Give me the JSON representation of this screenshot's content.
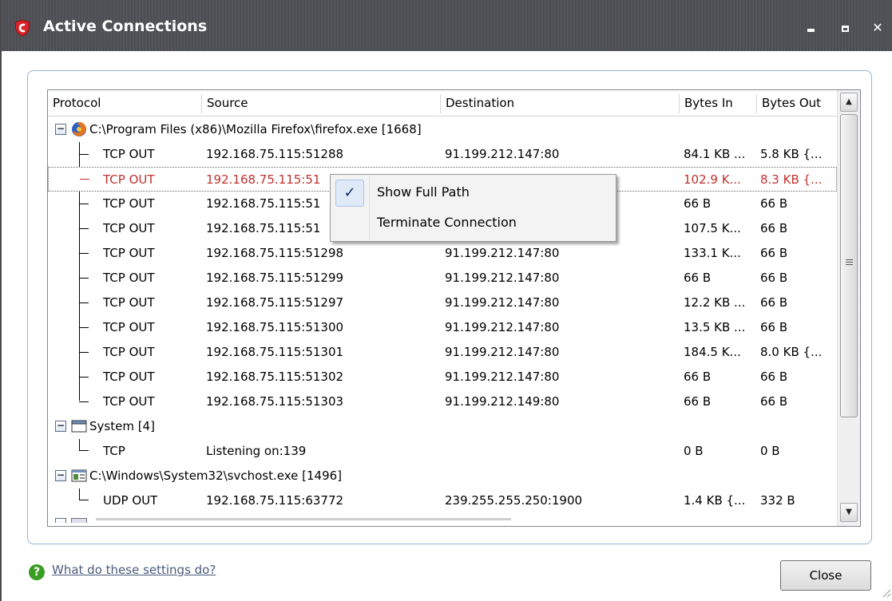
{
  "window": {
    "title": "Active Connections",
    "app_icon": "comodo-shield-icon",
    "close_glyph": "✕"
  },
  "table": {
    "columns": [
      "Protocol",
      "Source",
      "Destination",
      "Bytes In",
      "Bytes Out"
    ],
    "groups": [
      {
        "label": "C:\\Program Files (x86)\\Mozilla Firefox\\firefox.exe [1668]",
        "icon": "firefox-icon",
        "expander": "−",
        "rows": [
          {
            "protocol": "TCP OUT",
            "source": "192.168.75.115:51288",
            "destination": "91.199.212.147:80",
            "bytes_in": "84.1 KB ...",
            "bytes_out": "5.8 KB {..."
          },
          {
            "protocol": "TCP OUT",
            "source": "192.168.75.115:51",
            "destination": "",
            "bytes_in": "102.9 K...",
            "bytes_out": "8.3 KB {..."
          },
          {
            "protocol": "TCP OUT",
            "source": "192.168.75.115:51",
            "destination": "",
            "bytes_in": "66 B",
            "bytes_out": "66 B"
          },
          {
            "protocol": "TCP OUT",
            "source": "192.168.75.115:51",
            "destination": "",
            "bytes_in": "107.5 K...",
            "bytes_out": "66 B"
          },
          {
            "protocol": "TCP OUT",
            "source": "192.168.75.115:51298",
            "destination": "91.199.212.147:80",
            "bytes_in": "133.1 K...",
            "bytes_out": "66 B"
          },
          {
            "protocol": "TCP OUT",
            "source": "192.168.75.115:51299",
            "destination": "91.199.212.147:80",
            "bytes_in": "66 B",
            "bytes_out": "66 B"
          },
          {
            "protocol": "TCP OUT",
            "source": "192.168.75.115:51297",
            "destination": "91.199.212.147:80",
            "bytes_in": "12.2 KB ...",
            "bytes_out": "66 B"
          },
          {
            "protocol": "TCP OUT",
            "source": "192.168.75.115:51300",
            "destination": "91.199.212.147:80",
            "bytes_in": "13.5 KB ...",
            "bytes_out": "66 B"
          },
          {
            "protocol": "TCP OUT",
            "source": "192.168.75.115:51301",
            "destination": "91.199.212.147:80",
            "bytes_in": "184.5 K...",
            "bytes_out": "8.0 KB {..."
          },
          {
            "protocol": "TCP OUT",
            "source": "192.168.75.115:51302",
            "destination": "91.199.212.147:80",
            "bytes_in": "66 B",
            "bytes_out": "66 B"
          },
          {
            "protocol": "TCP OUT",
            "source": "192.168.75.115:51303",
            "destination": "91.199.212.149:80",
            "bytes_in": "66 B",
            "bytes_out": "66 B"
          }
        ]
      },
      {
        "label": "System [4]",
        "icon": "window-icon",
        "expander": "−",
        "rows": [
          {
            "protocol": "TCP",
            "source": "Listening on:139",
            "destination": "",
            "bytes_in": "0 B",
            "bytes_out": "0 B"
          }
        ]
      },
      {
        "label": "C:\\Windows\\System32\\svchost.exe [1496]",
        "icon": "service-window-icon",
        "expander": "−",
        "rows": [
          {
            "protocol": "UDP OUT",
            "source": "192.168.75.115:63772",
            "destination": "239.255.255.250:1900",
            "bytes_in": "1.4 KB {...",
            "bytes_out": "332 B"
          }
        ]
      }
    ],
    "selected_row": "TCP OUT 192.168.75.115:51 (row 2)"
  },
  "context_menu": {
    "items": [
      {
        "label": "Show Full Path",
        "checked": true
      },
      {
        "label": "Terminate Connection",
        "checked": false
      }
    ],
    "check_glyph": "✓"
  },
  "footer": {
    "help_text": "What do these settings do?",
    "help_icon_glyph": "?",
    "close_label": "Close"
  },
  "colors": {
    "titlebar": "#4f5156",
    "selected_text": "#c0302f",
    "panel_border": "#99b4d1",
    "help_icon": "#3a9d23"
  }
}
